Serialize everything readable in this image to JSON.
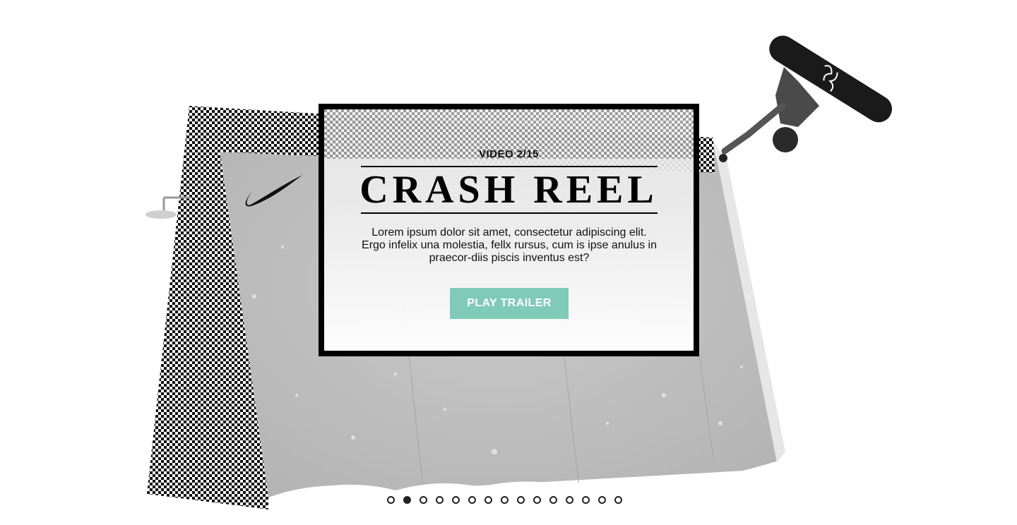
{
  "hero": {
    "kicker": "VIDEO 2/15",
    "title": "CRASH REEL",
    "description": "Lorem ipsum dolor sit amet, consectetur adipiscing elit. Ergo infelix una molestia, fellx rursus, cum is ipse anulus in praecor-diis piscis inventus est?",
    "cta_label": "PLAY TRAILER",
    "accent_color": "#7fcbb8"
  },
  "pager": {
    "total": 15,
    "current": 2
  },
  "imagery": {
    "brand_logo": "swoosh-logo",
    "rider": "snowboarder-photo",
    "ramp": "halfpipe-ramp-photo"
  }
}
